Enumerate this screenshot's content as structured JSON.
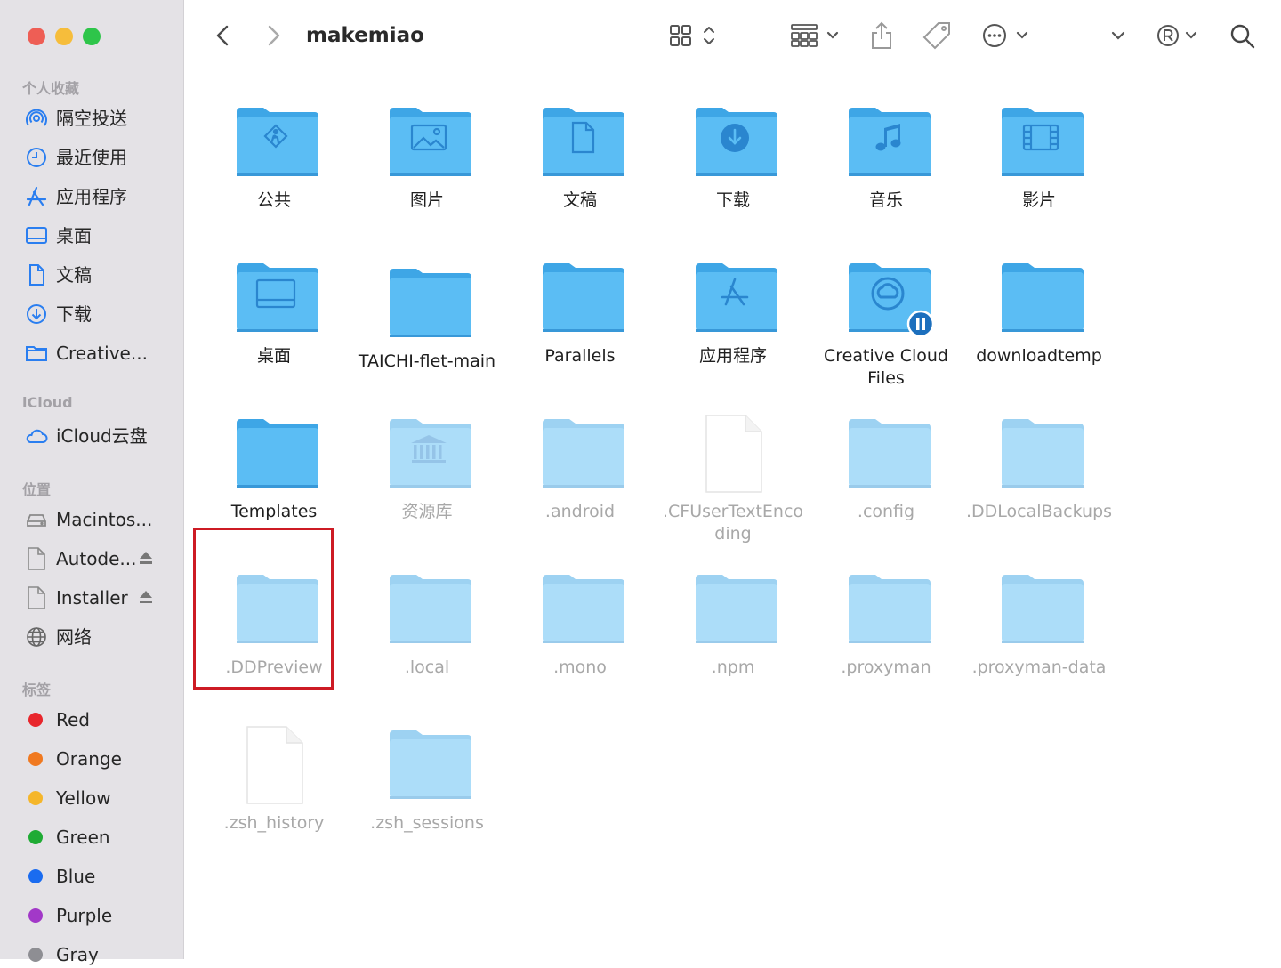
{
  "window": {
    "title": "makemiao"
  },
  "sidebar": {
    "favorites_title": "个人收藏",
    "favorites": [
      {
        "label": "隔空投送",
        "icon": "airdrop-icon"
      },
      {
        "label": "最近使用",
        "icon": "clock-icon"
      },
      {
        "label": "应用程序",
        "icon": "applications-icon"
      },
      {
        "label": "桌面",
        "icon": "desktop-icon"
      },
      {
        "label": "文稿",
        "icon": "document-icon"
      },
      {
        "label": "下载",
        "icon": "download-icon"
      },
      {
        "label": "Creative...",
        "icon": "folder-icon"
      }
    ],
    "icloud_title": "iCloud",
    "icloud": [
      {
        "label": "iCloud云盘",
        "icon": "cloud-icon"
      }
    ],
    "locations_title": "位置",
    "locations": [
      {
        "label": "Macintos...",
        "icon": "disk-icon"
      },
      {
        "label": "Autode...",
        "icon": "file-icon"
      },
      {
        "label": "Installer",
        "icon": "file-icon"
      },
      {
        "label": "网络",
        "icon": "network-icon"
      }
    ],
    "tags_title": "标签",
    "tags": [
      {
        "label": "Red",
        "color": "#e8262c"
      },
      {
        "label": "Orange",
        "color": "#f07920"
      },
      {
        "label": "Yellow",
        "color": "#f5b62a"
      },
      {
        "label": "Green",
        "color": "#1fab34"
      },
      {
        "label": "Blue",
        "color": "#1a6cf0"
      },
      {
        "label": "Purple",
        "color": "#a238c8"
      },
      {
        "label": "Gray",
        "color": "#8e8e93"
      }
    ]
  },
  "items": [
    {
      "name": "公共",
      "icon": "public-folder-icon"
    },
    {
      "name": "图片",
      "icon": "pictures-folder-icon"
    },
    {
      "name": "文稿",
      "icon": "documents-folder-icon"
    },
    {
      "name": "下载",
      "icon": "downloads-folder-icon"
    },
    {
      "name": "音乐",
      "icon": "music-folder-icon"
    },
    {
      "name": "影片",
      "icon": "movies-folder-icon"
    },
    {
      "name": "桌面",
      "icon": "desktop-folder-icon"
    },
    {
      "name": "TAICHI-flet-main",
      "icon": "folder-icon"
    },
    {
      "name": "Parallels",
      "icon": "folder-icon"
    },
    {
      "name": "应用程序",
      "icon": "applications-folder-icon"
    },
    {
      "name": "Creative Cloud Files",
      "icon": "creative-cloud-folder-icon"
    },
    {
      "name": "downloadtemp",
      "icon": "folder-icon"
    },
    {
      "name": "Templates",
      "icon": "folder-icon"
    },
    {
      "name": "资源库",
      "icon": "library-folder-icon"
    },
    {
      "name": ".android",
      "icon": "folder-icon"
    },
    {
      "name": ".CFUserTextEncoding",
      "icon": "file-icon"
    },
    {
      "name": ".config",
      "icon": "folder-icon"
    },
    {
      "name": ".DDLocalBackups",
      "icon": "folder-icon"
    },
    {
      "name": ".DDPreview",
      "icon": "folder-icon"
    },
    {
      "name": ".local",
      "icon": "folder-icon"
    },
    {
      "name": ".mono",
      "icon": "folder-icon"
    },
    {
      "name": ".npm",
      "icon": "folder-icon"
    },
    {
      "name": ".proxyman",
      "icon": "folder-icon"
    },
    {
      "name": ".proxyman-data",
      "icon": "folder-icon"
    },
    {
      "name": ".zsh_history",
      "icon": "file-icon"
    },
    {
      "name": ".zsh_sessions",
      "icon": "folder-icon"
    }
  ],
  "colors": {
    "folder": "#5bbdf4",
    "folder_dark": "#3ea6e6",
    "highlight": "#cd1b24"
  }
}
